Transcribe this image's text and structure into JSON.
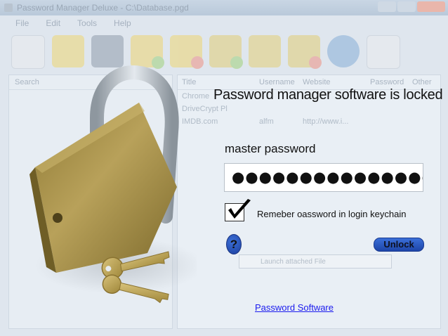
{
  "background_window": {
    "title": "Password Manager Deluxe - C:\\Database.pgd",
    "menu": [
      "File",
      "Edit",
      "Tools",
      "Help"
    ],
    "left_panel_header": "Search",
    "columns": [
      "Title",
      "Username",
      "Website",
      "Password",
      "Other"
    ],
    "rows": [
      {
        "title": "Chrome",
        "username": "",
        "website": "",
        "password": "",
        "other": ""
      },
      {
        "title": "DriveCrypt Pl",
        "username": "",
        "website": "",
        "password": "",
        "other": ""
      },
      {
        "title": "IMDB.com",
        "username": "alfm",
        "website": "http://www.i...",
        "password": "",
        "other": ""
      }
    ],
    "bottom_field": "Launch attached File"
  },
  "dialog": {
    "title": "Password manager software is locked",
    "password_label": "master password",
    "password_value": "●●●●●●●●●●●●●●●●●●●",
    "remember_checked": true,
    "remember_label": "Remeber oassword in login keychain",
    "help_label": "?",
    "unlock_label": "Unlock"
  },
  "footer": {
    "link_text": "Password  Software"
  },
  "colors": {
    "accent_blue": "#1d45a8",
    "link_blue": "#1a1aee",
    "lock_brass": "#a88d3e",
    "shackle_steel": "#b9c2cb"
  }
}
